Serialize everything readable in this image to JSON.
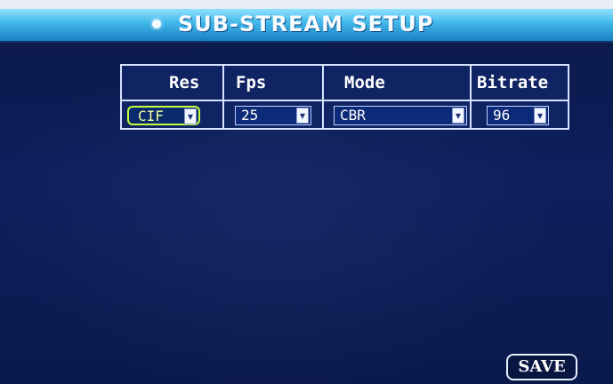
{
  "title": "SUB-STREAM SETUP",
  "columns": [
    {
      "header": "Res",
      "value": "CIF"
    },
    {
      "header": "Fps",
      "value": "25"
    },
    {
      "header": "Mode",
      "value": "CBR"
    },
    {
      "header": "Bitrate",
      "value": "96"
    }
  ],
  "icons": {
    "dropdown_arrow": "chevron-down-icon",
    "title_bullet": "dot-icon"
  },
  "save_label": "SAVE",
  "colors": {
    "title_bar": "#3fb6e9",
    "background": "#0d1f5d",
    "grid_lines": "#d7e2ff",
    "focus": "#c8ff3d"
  }
}
